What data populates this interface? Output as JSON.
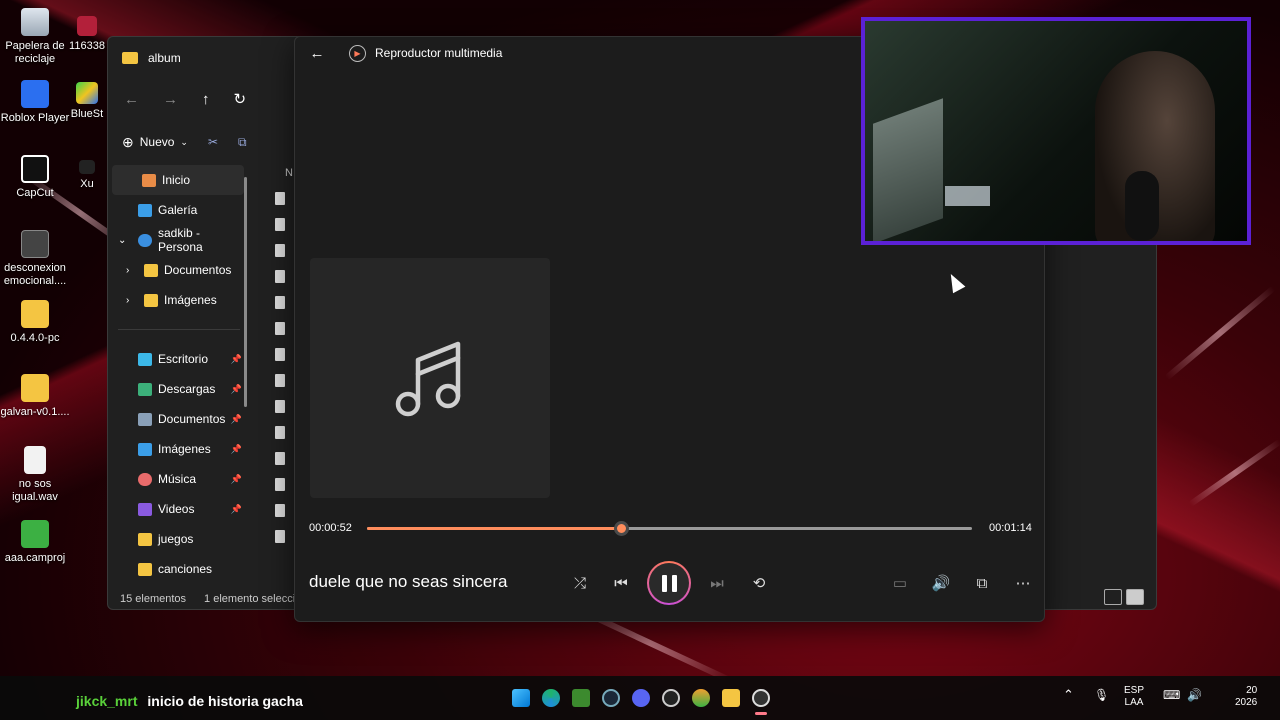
{
  "desktop_icons": [
    {
      "label": "Papelera de reciclaje",
      "icon": "recycle-bin-icon"
    },
    {
      "label": "Roblox Player",
      "icon": "roblox-icon"
    },
    {
      "label": "CapCut",
      "icon": "capcut-icon"
    },
    {
      "label": "desconexion emocional....",
      "icon": "video-file-icon"
    },
    {
      "label": "0.4.4.0-pc",
      "icon": "folder-icon"
    },
    {
      "label": "galvan-v0.1....",
      "icon": "folder-icon"
    },
    {
      "label": "no sos igual.wav",
      "icon": "audio-file-icon"
    },
    {
      "label": "aaa.camproj",
      "icon": "project-file-icon"
    }
  ],
  "desktop_icons_col2": [
    {
      "label": "116338",
      "icon": "app-icon"
    },
    {
      "label": "BlueSt",
      "icon": "bluestacks-icon"
    },
    {
      "label": "Xu",
      "icon": "app-icon"
    }
  ],
  "explorer": {
    "title": "album",
    "new_label": "Nuevo",
    "column_header": "N",
    "sidebar": [
      {
        "label": "Inicio",
        "icon": "home-icon",
        "selected": true,
        "pinned": false
      },
      {
        "label": "Galería",
        "icon": "gallery-icon",
        "pinned": false
      },
      {
        "label": "sadkib - Persona",
        "icon": "cloud-icon",
        "pinned": false
      },
      {
        "label": "Documentos",
        "icon": "folder-icon",
        "pinned": false
      },
      {
        "label": "Imágenes",
        "icon": "folder-icon",
        "pinned": false
      },
      {
        "label": "Escritorio",
        "icon": "desktop-icon",
        "pinned": true
      },
      {
        "label": "Descargas",
        "icon": "download-icon",
        "pinned": true
      },
      {
        "label": "Documentos",
        "icon": "document-icon",
        "pinned": true
      },
      {
        "label": "Imágenes",
        "icon": "image-icon",
        "pinned": true
      },
      {
        "label": "Música",
        "icon": "music-icon",
        "pinned": true
      },
      {
        "label": "Videos",
        "icon": "video-icon",
        "pinned": true
      },
      {
        "label": "juegos",
        "icon": "folder-icon",
        "pinned": false
      },
      {
        "label": "canciones",
        "icon": "folder-icon",
        "pinned": false
      }
    ],
    "status_count": "15 elementos",
    "status_selected": "1 elemento selecci"
  },
  "player": {
    "app_title": "Reproductor multimedia",
    "current_time": "00:00:52",
    "total_time": "00:01:14",
    "progress": 0.42,
    "song_title": "duele que no seas sincera",
    "accent_color": "#ff8d5c"
  },
  "chat": {
    "user": "jikck_mrt",
    "message": "inicio de historia gacha"
  },
  "tray": {
    "lang_top": "ESP",
    "lang_bottom": "LAA",
    "clock_time": "20",
    "clock_date": "2026"
  }
}
